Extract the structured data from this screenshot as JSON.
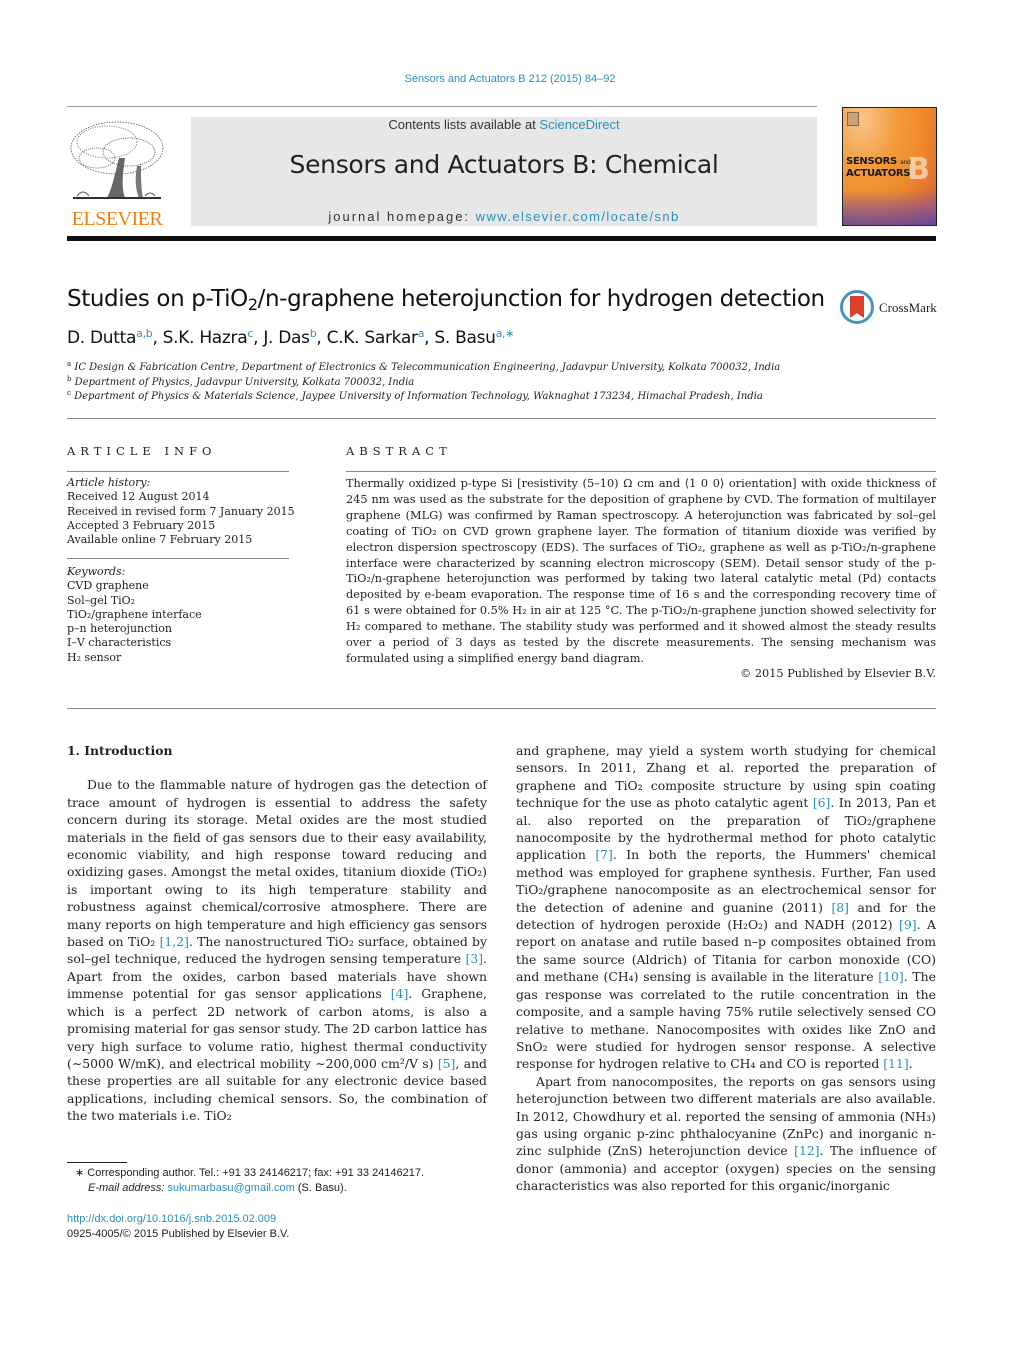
{
  "header": {
    "citation": "Sensors and Actuators B 212 (2015) 84–92",
    "contents_prefix": "Contents lists available at ",
    "contents_link": "ScienceDirect",
    "journal_title": "Sensors and Actuators B: Chemical",
    "homepage_prefix": "journal homepage: ",
    "homepage_link": "www.elsevier.com/locate/snb",
    "publisher_logo_text": "ELSEVIER",
    "cover": {
      "title_line1": "SENSORS",
      "title_and": "and",
      "title_line2": "ACTUATORS",
      "letter": "B"
    },
    "colors": {
      "link": "#2a8fbd",
      "elsevier_orange": "#f07f14",
      "masthead_bg": "#e7e7e7"
    }
  },
  "article": {
    "title_pre": "Studies on p-TiO",
    "title_sub": "2",
    "title_post": "/n-graphene heterojunction for hydrogen detection",
    "crossmark_label": "CrossMark",
    "authors": [
      {
        "name": "D. Dutta",
        "sup": "a,b",
        "sep": ", "
      },
      {
        "name": "S.K. Hazra",
        "sup": "c",
        "sep": ", "
      },
      {
        "name": "J. Das",
        "sup": "b",
        "sep": ", "
      },
      {
        "name": "C.K. Sarkar",
        "sup": "a",
        "sep": ", "
      },
      {
        "name": "S. Basu",
        "sup": "a,∗",
        "sep": ""
      }
    ],
    "affiliations": [
      {
        "key": "a",
        "text": "IC Design & Fabrication Centre, Department of Electronics & Telecommunication Engineering, Jadavpur University, Kolkata 700032, India"
      },
      {
        "key": "b",
        "text": "Department of Physics, Jadavpur University, Kolkata 700032, India"
      },
      {
        "key": "c",
        "text": "Department of Physics & Materials Science, Jaypee University of Information Technology, Waknaghat 173234, Himachal Pradesh, India"
      }
    ]
  },
  "article_info": {
    "heading": "ARTICLE INFO",
    "history_label": "Article history:",
    "history": [
      "Received 12 August 2014",
      "Received in revised form 7 January 2015",
      "Accepted 3 February 2015",
      "Available online 7 February 2015"
    ],
    "keywords_label": "Keywords:",
    "keywords": [
      "CVD graphene",
      "Sol–gel TiO₂",
      "TiO₂/graphene interface",
      "p–n heterojunction",
      "I–V characteristics",
      "H₂ sensor"
    ]
  },
  "abstract": {
    "heading": "ABSTRACT",
    "text": "Thermally oxidized p-type Si [resistivity (5–10) Ω cm and ⟨1 0 0⟩ orientation] with oxide thickness of 245 nm was used as the substrate for the deposition of graphene by CVD. The formation of multilayer graphene (MLG) was confirmed by Raman spectroscopy. A heterojunction was fabricated by sol–gel coating of TiO₂ on CVD grown graphene layer. The formation of titanium dioxide was verified by electron dispersion spectroscopy (EDS). The surfaces of TiO₂, graphene as well as p-TiO₂/n-graphene interface were characterized by scanning electron microscopy (SEM). Detail sensor study of the p-TiO₂/n-graphene heterojunction was performed by taking two lateral catalytic metal (Pd) contacts deposited by e-beam evaporation. The response time of 16 s and the corresponding recovery time of 61 s were obtained for 0.5% H₂ in air at 125 °C. The p-TiO₂/n-graphene junction showed selectivity for H₂ compared to methane. The stability study was performed and it showed almost the steady results over a period of 3 days as tested by the discrete measurements. The sensing mechanism was formulated using a simplified energy band diagram.",
    "copyright": "© 2015 Published by Elsevier B.V."
  },
  "body": {
    "section_heading": "1.  Introduction",
    "left_paragraph": [
      {
        "t": "Due to the flammable nature of hydrogen gas the detection of trace amount of hydrogen is essential to address the safety concern during its storage. Metal oxides are the most studied materials in the field of gas sensors due to their easy availability, economic viability, and high response toward reducing and oxidizing gases. Amongst the metal oxides, titanium dioxide (TiO₂) is important owing to its high temperature stability and robustness against chemical/corrosive atmosphere. There are many reports on high temperature and high efficiency gas sensors based on TiO₂ "
      },
      {
        "ref": "[1,2]"
      },
      {
        "t": ". The nanostructured TiO₂ surface, obtained by sol–gel technique, reduced the hydrogen sensing temperature "
      },
      {
        "ref": "[3]"
      },
      {
        "t": ". Apart from the oxides, carbon based materials have shown immense potential for gas sensor applications "
      },
      {
        "ref": "[4]"
      },
      {
        "t": ". Graphene, which is a perfect 2D network of carbon atoms, is also a promising material for gas sensor study. The 2D carbon lattice has very high surface to volume ratio, highest thermal conductivity (∼5000 W/mK), and electrical mobility ∼200,000 cm²/V s) "
      },
      {
        "ref": "[5]"
      },
      {
        "t": ", and these properties are all suitable for any electronic device based applications, including chemical sensors. So, the combination of the two materials i.e. TiO₂"
      }
    ],
    "right_paragraph_1": [
      {
        "t": "and graphene, may yield a system worth studying for chemical sensors. In 2011, Zhang et al. reported the preparation of graphene and TiO₂ composite structure by using spin coating technique for the use as photo catalytic agent "
      },
      {
        "ref": "[6]"
      },
      {
        "t": ". In 2013, Pan et al. also reported on the preparation of TiO₂/graphene nanocomposite by the hydrothermal method for photo catalytic application "
      },
      {
        "ref": "[7]"
      },
      {
        "t": ". In both the reports, the Hummers' chemical method was employed for graphene synthesis. Further, Fan used TiO₂/graphene nanocomposite as an electrochemical sensor for the detection of adenine and guanine (2011) "
      },
      {
        "ref": "[8]"
      },
      {
        "t": " and for the detection of hydrogen peroxide (H₂O₂) and NADH (2012) "
      },
      {
        "ref": "[9]"
      },
      {
        "t": ". A report on anatase and rutile based n–p composites obtained from the same source (Aldrich) of Titania for carbon monoxide (CO) and methane (CH₄) sensing is available in the literature "
      },
      {
        "ref": "[10]"
      },
      {
        "t": ". The gas response was correlated to the rutile concentration in the composite, and a sample having 75% rutile selectively sensed CO relative to methane. Nanocomposites with oxides like ZnO and SnO₂ were studied for hydrogen sensor response. A selective response for hydrogen relative to CH₄ and CO is reported "
      },
      {
        "ref": "[11]"
      },
      {
        "t": "."
      }
    ],
    "right_paragraph_2": [
      {
        "t": "Apart from nanocomposites, the reports on gas sensors using heterojunction between two different materials are also available. In 2012, Chowdhury et al. reported the sensing of ammonia (NH₃) gas using organic p-zinc phthalocyanine (ZnPc) and inorganic n-zinc sulphide (ZnS) heterojunction device "
      },
      {
        "ref": "[12]"
      },
      {
        "t": ". The influence of donor (ammonia) and acceptor (oxygen) species on the sensing characteristics was also reported for this organic/inorganic"
      }
    ]
  },
  "footer": {
    "corresponding": "∗  Corresponding author. Tel.: +91 33 24146217; fax: +91 33 24146217.",
    "email_label": "E-mail address:",
    "email": "sukumarbasu@gmail.com",
    "email_suffix": " (S. Basu).",
    "doi": "http://dx.doi.org/10.1016/j.snb.2015.02.009",
    "issn_line": "0925-4005/© 2015 Published by Elsevier B.V."
  }
}
